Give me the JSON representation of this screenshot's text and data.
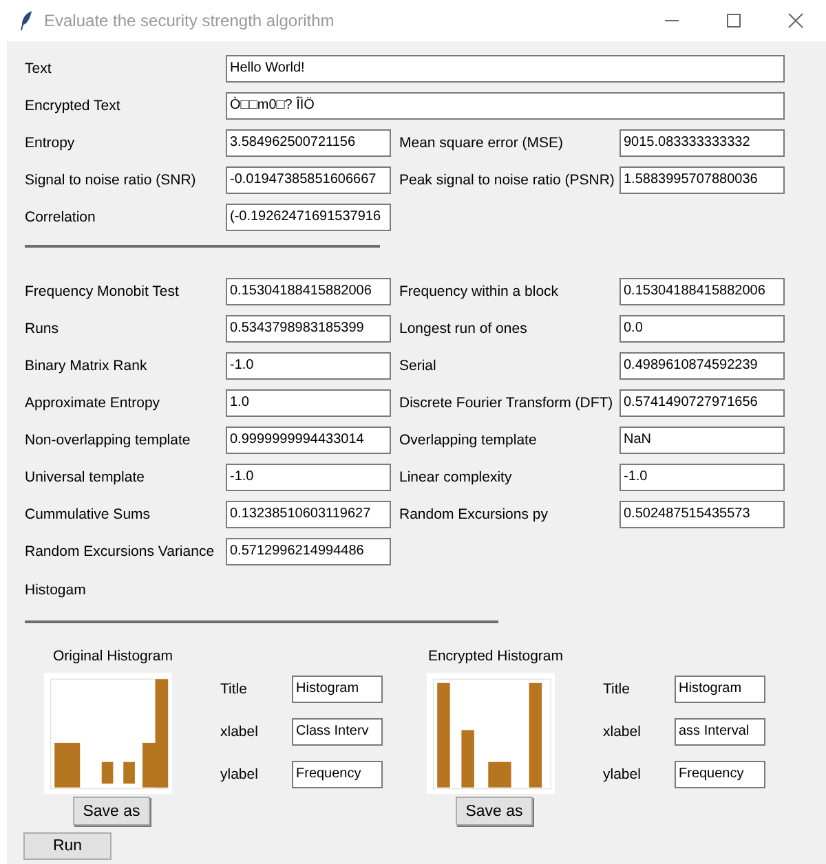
{
  "window": {
    "title": "Evaluate the security strength algorithm"
  },
  "summary_rows": [
    [
      {
        "label": "Text",
        "value": "Hello World!",
        "kind": "wide"
      }
    ],
    [
      {
        "label": "Encrypted Text",
        "value": "Ò□□m0□? ÎÌÖ",
        "kind": "wide"
      }
    ],
    [
      {
        "label": "Entropy",
        "value": "3.584962500721156",
        "kind": "short"
      },
      {
        "label": "Mean square error (MSE)",
        "value": "9015.083333333332",
        "kind": "short"
      }
    ],
    [
      {
        "label": "Signal to noise ratio (SNR)",
        "value": "-0.01947385851606667",
        "kind": "short"
      },
      {
        "label": "Peak signal to noise ratio (PSNR)",
        "value": "1.5883995707880036",
        "kind": "short"
      }
    ],
    [
      {
        "label": "Correlation",
        "value": "(-0.19262471691537916",
        "kind": "short"
      }
    ]
  ],
  "test_rows": [
    [
      {
        "label": "Frequency Monobit Test",
        "value": "0.15304188415882006",
        "kind": "short"
      },
      {
        "label": "Frequency within a block",
        "value": "0.15304188415882006",
        "kind": "short"
      }
    ],
    [
      {
        "label": "Runs",
        "value": "0.5343798983185399",
        "kind": "short"
      },
      {
        "label": "Longest run of ones",
        "value": "0.0",
        "kind": "short"
      }
    ],
    [
      {
        "label": "Binary Matrix Rank",
        "value": "-1.0",
        "kind": "short"
      },
      {
        "label": "Serial",
        "value": "0.4989610874592239",
        "kind": "short"
      }
    ],
    [
      {
        "label": "Approximate Entropy",
        "value": "1.0",
        "kind": "short"
      },
      {
        "label": "Discrete Fourier Transform (DFT)",
        "value": "0.5741490727971656",
        "kind": "short"
      }
    ],
    [
      {
        "label": "Non-overlapping template",
        "value": "0.9999999994433014",
        "kind": "short"
      },
      {
        "label": "Overlapping template",
        "value": "NaN",
        "kind": "short"
      }
    ],
    [
      {
        "label": "Universal template",
        "value": "-1.0",
        "kind": "short"
      },
      {
        "label": "Linear complexity",
        "value": "-1.0",
        "kind": "short"
      }
    ],
    [
      {
        "label": "Cummulative Sums",
        "value": "0.13238510603119627",
        "kind": "short"
      },
      {
        "label": "Random Excursions py",
        "value": "0.502487515435573",
        "kind": "short"
      }
    ],
    [
      {
        "label": "Random Excursions Variance",
        "value": "0.5712996214994486",
        "kind": "short"
      }
    ]
  ],
  "histogram_heading": "Histogam",
  "histograms": [
    {
      "title": "Original Histogram",
      "fields": [
        {
          "label": "Title",
          "value": "Histogram"
        },
        {
          "label": "xlabel",
          "value": "Class Interv"
        },
        {
          "label": "ylabel",
          "value": "Frequency"
        }
      ],
      "button": "Save as"
    },
    {
      "title": "Encrypted Histogram",
      "fields": [
        {
          "label": "Title",
          "value": "Histogram"
        },
        {
          "label": "xlabel",
          "value": "ass Interval"
        },
        {
          "label": "ylabel",
          "value": "Frequency"
        }
      ],
      "button": "Save as"
    }
  ],
  "run_button": "Run"
}
